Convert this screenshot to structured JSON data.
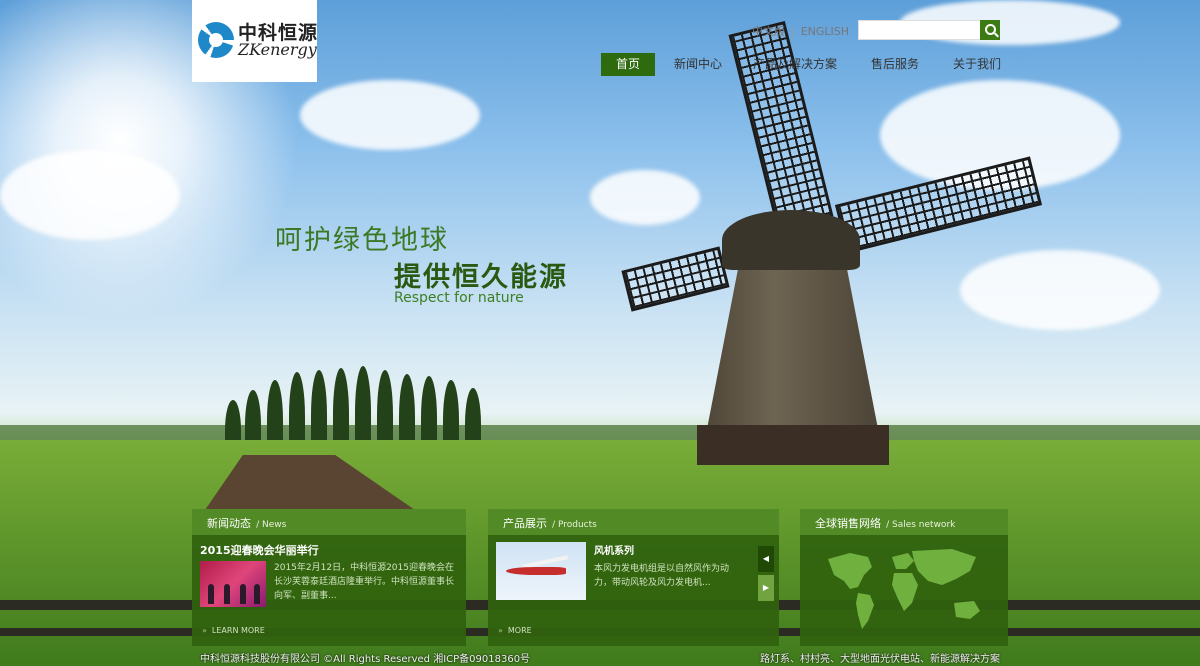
{
  "logo": {
    "cn": "中科恒源",
    "en": "ZKenergy"
  },
  "lang": {
    "zh": "中文版",
    "separator": "|",
    "en": "ENGLISH"
  },
  "search": {
    "placeholder": "",
    "value": ""
  },
  "nav": {
    "items": [
      {
        "label": "首页",
        "active": true
      },
      {
        "label": "新闻中心",
        "active": false
      },
      {
        "label": "产品及解决方案",
        "active": false
      },
      {
        "label": "售后服务",
        "active": false
      },
      {
        "label": "关于我们",
        "active": false
      }
    ]
  },
  "hero": {
    "line1": "呵护绿色地球",
    "line2": "提供恒久能源",
    "line3": "Respect for nature"
  },
  "panels": {
    "news": {
      "title": "新闻动态",
      "sub": "/ News",
      "headline": "2015迎春晚会华丽举行",
      "summary": "2015年2月12日，中科恒源2015迎春晚会在长沙芙蓉泰廷酒店隆重举行。中科恒源董事长向军、副董事...",
      "more": "LEARN MORE"
    },
    "products": {
      "title": "产品展示",
      "sub": "/ Products",
      "name": "风机系列",
      "summary": "本风力发电机组是以自然风作为动力，带动风轮及风力发电机...",
      "more": "MORE",
      "prev": "◀",
      "next": "▶"
    },
    "sales": {
      "title": "全球销售网络",
      "sub": "/ Sales network"
    }
  },
  "footer": {
    "copyright": "中科恒源科技股份有限公司 ©All Rights Reserved 湘ICP备09018360号",
    "links": "路灯系、村村亮、大型地面光伏电站、新能源解决方案"
  },
  "colors": {
    "brand_green": "#2e6a0e",
    "panel_green": "#30620e",
    "logo_blue": "#1e88c8"
  }
}
